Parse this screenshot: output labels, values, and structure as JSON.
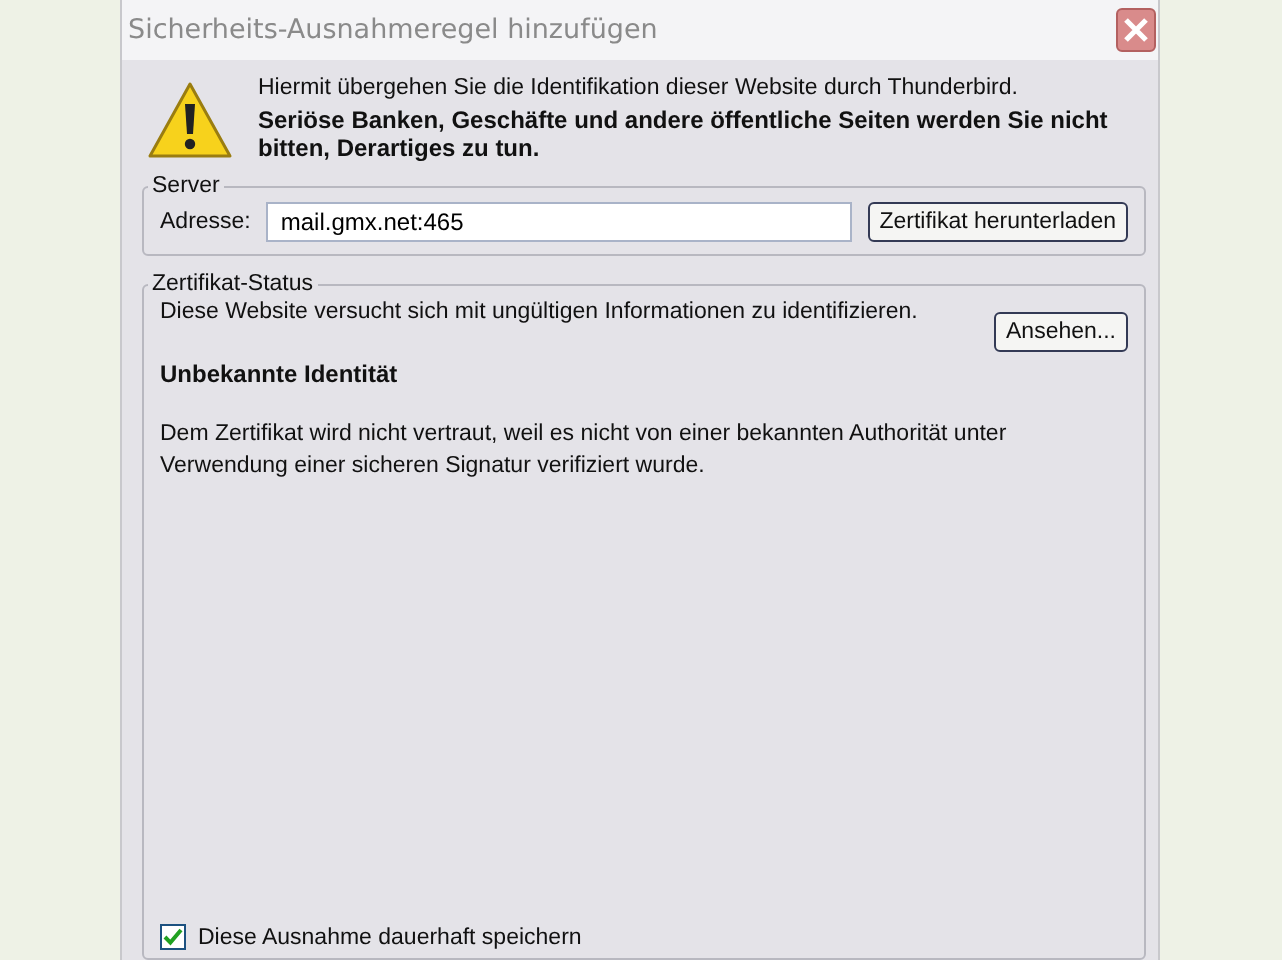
{
  "window": {
    "title": "Sicherheits-Ausnahmeregel hinzufügen"
  },
  "warning": {
    "line": "Hiermit übergehen Sie die Identifikation dieser Website durch Thunderbird.",
    "emphasis": "Seriöse Banken, Geschäfte und andere öffentliche Seiten werden Sie nicht bitten, Derartiges zu tun."
  },
  "server": {
    "legend": "Server",
    "address_label": "Adresse:",
    "address": "mail.gmx.net:465",
    "download_button": "Zertifikat herunterladen"
  },
  "status": {
    "legend": "Zertifikat-Status",
    "message": "Diese Website versucht sich mit ungültigen Informationen zu identifizieren.",
    "view_button": "Ansehen...",
    "heading": "Unbekannte Identität",
    "detail": "Dem Zertifikat wird nicht vertraut, weil es nicht von einer bekannten Authorität unter Verwendung einer sicheren Signatur verifiziert wurde."
  },
  "save_permanently": {
    "label": "Diese Ausnahme dauerhaft speichern",
    "checked": true
  }
}
